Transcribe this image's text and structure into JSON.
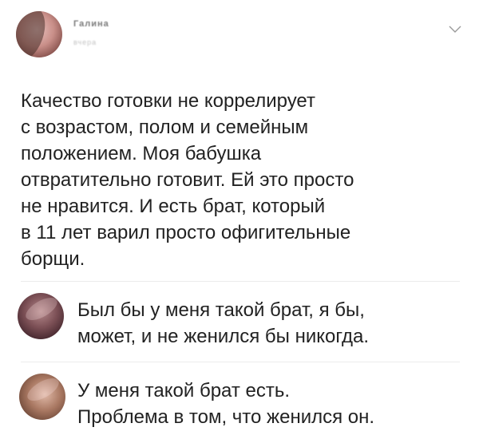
{
  "post": {
    "author_name": "Галина",
    "author_meta": "вчера",
    "text_lines": [
      "Качество готовки не коррелирует",
      "с возрастом, полом и семейным",
      "положением. Моя бабушка",
      "отвратительно готовит. Ей это просто",
      "не нравится. И есть брат, который",
      "в 11 лет варил просто офигительные",
      "борщи."
    ]
  },
  "comments": [
    {
      "text_lines": [
        "Был бы у меня такой брат, я бы,",
        "может, и не женился бы никогда."
      ]
    },
    {
      "text_lines": [
        "У меня такой брат есть.",
        "Проблема в том, что женился он."
      ]
    }
  ],
  "icons": {
    "menu": "chevron-down-icon"
  },
  "colors": {
    "text": "#222222",
    "divider": "#ececec",
    "icon": "#9a9a9a"
  }
}
